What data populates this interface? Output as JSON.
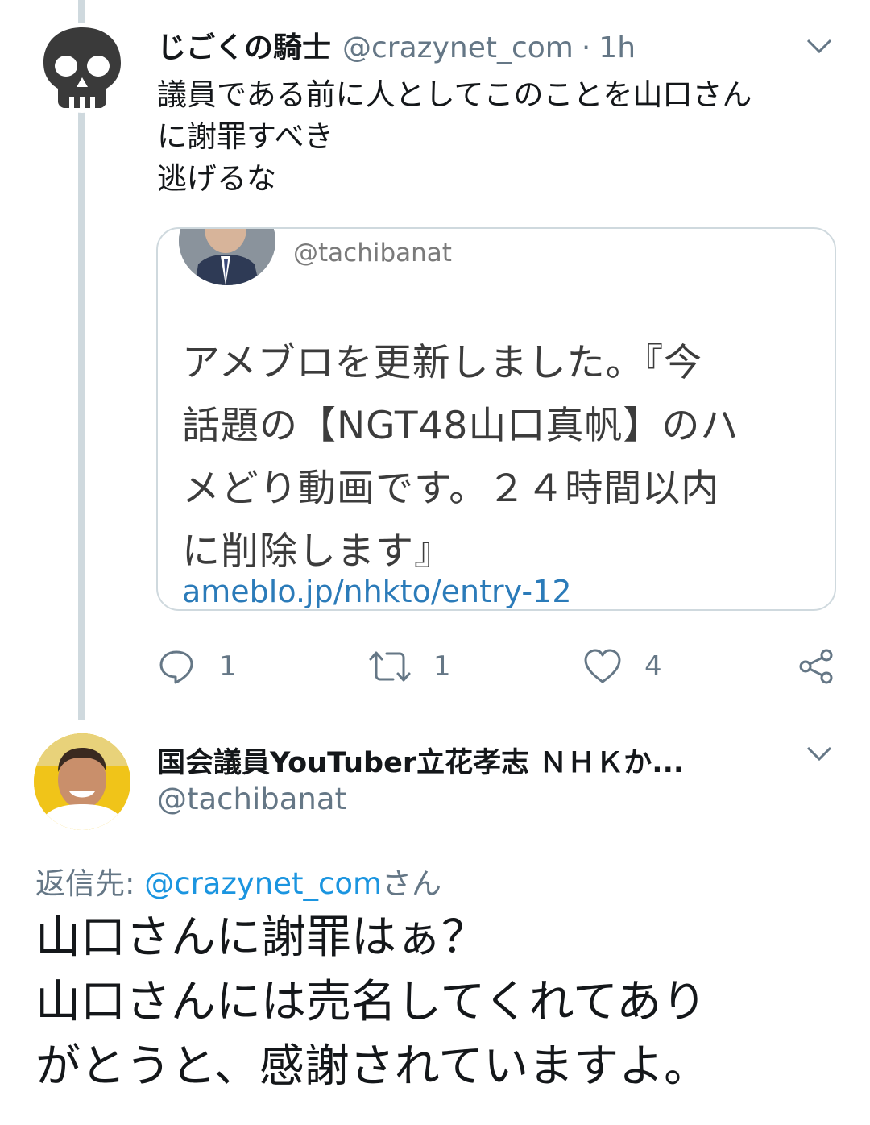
{
  "tweet1": {
    "display_name": "じごくの騎士",
    "handle": "@crazynet_com",
    "separator": "·",
    "time": "1h",
    "text_lines": [
      "議員である前に人としてこのことを山口さん",
      "に謝罪すべき",
      "逃げるな"
    ],
    "avatar_icon": "skull-icon",
    "quoted": {
      "handle": "@tachibanat",
      "text_lines": [
        "アメブロを更新しました。『今",
        "話題の【NGT48山口真帆】のハ",
        "メどり動画です。２４時間以内",
        "に削除します』"
      ],
      "link": "ameblo.jp/nhkto/entry-12"
    },
    "actions": {
      "reply_count": "1",
      "retweet_count": "1",
      "like_count": "4"
    }
  },
  "tweet2": {
    "display_name": "国会議員YouTuber立花孝志 ＮＨＫか...",
    "handle": "@tachibanat",
    "reply_prefix": "返信先: ",
    "reply_mention": "@crazynet_com",
    "reply_suffix": "さん",
    "text_lines": [
      "山口さんに謝罪はぁ？",
      "山口さんには売名してくれてあり",
      "がとうと、感謝されていますよ。"
    ]
  },
  "colors": {
    "primary_text": "#14171a",
    "secondary_text": "#657786",
    "link": "#1b95e0",
    "thread_line": "#cfd9de"
  }
}
